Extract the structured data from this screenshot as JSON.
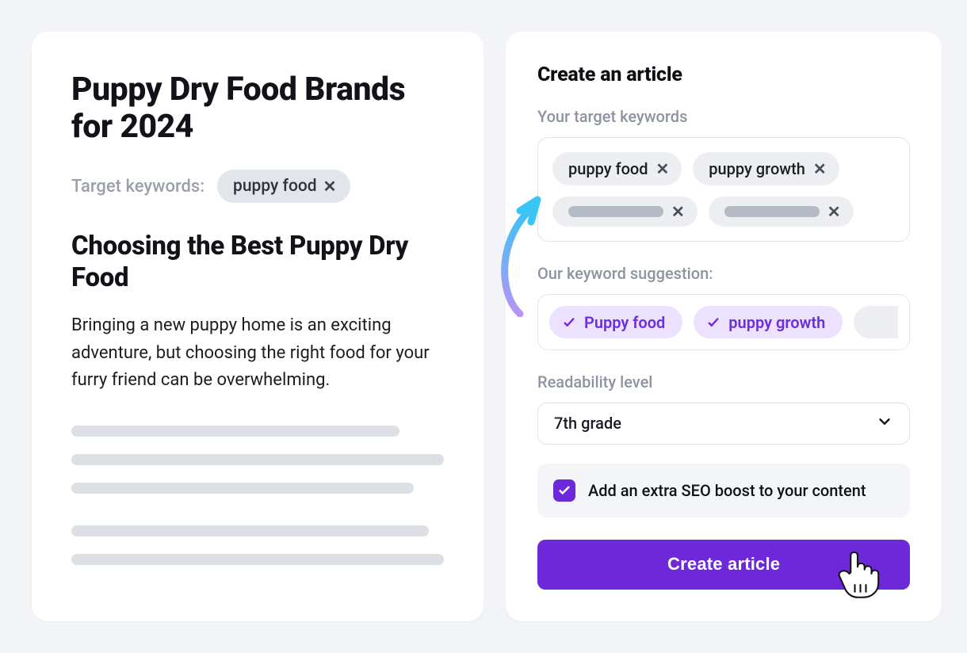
{
  "preview": {
    "title": "Puppy Dry Food Brands for 2024",
    "keywords_label": "Target keywords:",
    "keyword_chip": "puppy food",
    "subheading": "Choosing the Best Puppy Dry Food",
    "body": "Bringing a new puppy home is an exciting adventure, but choosing the right food for your furry friend can be overwhelming."
  },
  "form": {
    "heading": "Create an article",
    "keywords_label": "Your target keywords",
    "tags": [
      "puppy food",
      "puppy growth"
    ],
    "suggestion_label": "Our keyword suggestion:",
    "suggestions": [
      "Puppy food",
      "puppy growth"
    ],
    "readability_label": "Readability level",
    "readability_value": "7th grade",
    "boost_label": "Add an extra SEO boost to your content",
    "cta_label": "Create article"
  }
}
